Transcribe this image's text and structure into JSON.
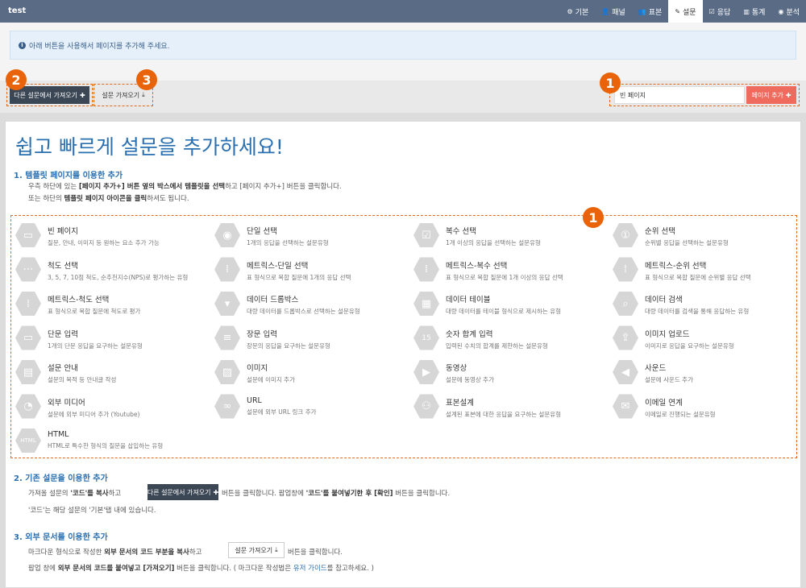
{
  "app": {
    "title": "test"
  },
  "nav": [
    {
      "label": "기본",
      "icon": "gear-icon",
      "glyph": "⚙"
    },
    {
      "label": "패널",
      "icon": "user-icon",
      "glyph": "👤"
    },
    {
      "label": "표본",
      "icon": "users-icon",
      "glyph": "👥"
    },
    {
      "label": "설문",
      "icon": "pencil-icon",
      "glyph": "✎"
    },
    {
      "label": "응답",
      "icon": "check-square-icon",
      "glyph": "☑"
    },
    {
      "label": "통계",
      "icon": "bar-chart-icon",
      "glyph": "▥"
    },
    {
      "label": "분석",
      "icon": "eye-icon",
      "glyph": "◉"
    }
  ],
  "info": {
    "icon": "info-icon",
    "text": "아래 버튼을 사용해서 페이지를 추가해 주세요."
  },
  "toolbar": {
    "import_other_label": "다른 설문에서 가져오기",
    "import_survey_label": "설문 가져오기",
    "page_input_value": "빈 페이지",
    "add_page_label": "페이지 추가",
    "badges": [
      "2",
      "3",
      "1"
    ]
  },
  "main": {
    "heading": "쉽고 빠르게 설문을 추가하세요!",
    "section1": {
      "title": "1. 템플릿 페이지를 이용한 추가",
      "line1_a": "우측 하단에 있는 ",
      "line1_b": "[페이지 추가+] 버튼 옆의 박스에서 템플릿을 선택",
      "line1_c": "하고 [페이지 추가+] 버튼을 클릭합니다.",
      "line2_a": "또는 하단의 ",
      "line2_b": "템플릿 페이지 아이콘을 클릭",
      "line2_c": "하셔도 됩니다.",
      "badge": "1"
    },
    "templates": [
      {
        "name": "빈 페이지",
        "desc": "질문, 안내, 이미지 등 원하는 요소 추가 가능",
        "icon": "blank-page-icon",
        "glyph": "▭"
      },
      {
        "name": "단일 선택",
        "desc": "1개의 응답을 선택하는 설문유형",
        "icon": "radio-icon",
        "glyph": "◉"
      },
      {
        "name": "복수 선택",
        "desc": "1개 이상의 응답을 선택하는 설문유형",
        "icon": "checkbox-multi-icon",
        "glyph": "☑"
      },
      {
        "name": "순위 선택",
        "desc": "순위별 응답을 선택하는 설문유형",
        "icon": "rank-icon",
        "glyph": "①"
      },
      {
        "name": "척도 선택",
        "desc": "3, 5, 7, 10점 척도, 순추천지수(NPS)로 평가하는 유형",
        "icon": "scale-icon",
        "glyph": "⋯"
      },
      {
        "name": "메트릭스-단일 선택",
        "desc": "표 형식으로 복합 질문에 1개의 응답 선택",
        "icon": "matrix-single-icon",
        "glyph": "⁞"
      },
      {
        "name": "메트릭스-복수 선택",
        "desc": "표 형식으로 복합 질문에 1개 이상의 응답 선택",
        "icon": "matrix-multi-icon",
        "glyph": "⁞"
      },
      {
        "name": "메트릭스-순위 선택",
        "desc": "표 형식으로 복합 질문에 순위별 응답 선택",
        "icon": "matrix-rank-icon",
        "glyph": "⁞"
      },
      {
        "name": "메트릭스-척도 선택",
        "desc": "표 형식으로 복합 질문에 척도로 평가",
        "icon": "matrix-scale-icon",
        "glyph": "⁞"
      },
      {
        "name": "데이터 드롭박스",
        "desc": "대량 데이터를 드롭박스로 선택하는 설문유형",
        "icon": "dropdown-icon",
        "glyph": "▾"
      },
      {
        "name": "데이터 테이블",
        "desc": "대량 데이터를 테이블 형식으로 제시하는 유형",
        "icon": "table-icon",
        "glyph": "▦"
      },
      {
        "name": "데이터 검색",
        "desc": "대량 데이터를 검색을 통해 응답하는 유형",
        "icon": "search-box-icon",
        "glyph": "⌕"
      },
      {
        "name": "단문 입력",
        "desc": "1개의 단문 응답을 요구하는 설문유형",
        "icon": "short-text-icon",
        "glyph": "▭"
      },
      {
        "name": "장문 입력",
        "desc": "장문의 응답을 요구하는 설문유형",
        "icon": "long-text-icon",
        "glyph": "≡"
      },
      {
        "name": "숫자 합계 입력",
        "desc": "입력된 수치의 합계를 제한하는 설문유형",
        "icon": "number-sum-icon",
        "glyph": "15"
      },
      {
        "name": "이미지 업로드",
        "desc": "이미지로 응답을 요구하는 설문유형",
        "icon": "image-upload-icon",
        "glyph": "⇪"
      },
      {
        "name": "설문 안내",
        "desc": "설문의 목적 등 안내글 작성",
        "icon": "comment-icon",
        "glyph": "▤"
      },
      {
        "name": "이미지",
        "desc": "설문에 이미지 추가",
        "icon": "image-icon",
        "glyph": "▨"
      },
      {
        "name": "동영상",
        "desc": "설문에 동영상 추가",
        "icon": "video-icon",
        "glyph": "▶"
      },
      {
        "name": "사운드",
        "desc": "설문에 사운드 추가",
        "icon": "sound-icon",
        "glyph": "◀"
      },
      {
        "name": "외부 미디어",
        "desc": "설문에 외부 미디어 추가 (Youtube)",
        "icon": "rss-icon",
        "glyph": "◔"
      },
      {
        "name": "URL",
        "desc": "설문에 외부 URL 링크 추가",
        "icon": "link-icon",
        "glyph": "∞"
      },
      {
        "name": "표본설계",
        "desc": "설계된 표본에 대한 응답을 요구하는 설문유형",
        "icon": "sample-design-icon",
        "glyph": "⚇"
      },
      {
        "name": "이메일 연계",
        "desc": "이메일로 진행되는 설문유형",
        "icon": "email-icon",
        "glyph": "✉"
      },
      {
        "name": "HTML",
        "desc": "HTML로 특수한 형식의 질문을 삽입하는 유형",
        "icon": "html-file-icon",
        "glyph": "HTML"
      }
    ],
    "section2": {
      "title": "2. 기존 설문을 이용한 추가",
      "line1_a": "가져올 설문의 ",
      "line1_b": "'코드'를 복사",
      "line1_c": "하고",
      "button_label": "다른 설문에서 가져오기",
      "line1_d": "버튼을 클릭합니다. 팝업창에 ",
      "line1_e": "'코드'를 붙여넣기한 후 [확인]",
      "line1_f": " 버튼을 클릭합니다.",
      "line2": "'코드'는 해당 설문의 '기본'탭 내에 있습니다."
    },
    "section3": {
      "title": "3. 외부 문서를 이용한 추가",
      "line1_a": "마크다운 형식으로 작성한 ",
      "line1_b": "외부 문서의 코드 부분을 복사",
      "line1_c": "하고",
      "button_label": "설문 가져오기",
      "line1_d": "버튼을 클릭합니다.",
      "line2_a": "팝업 창에 ",
      "line2_b": "외부 문서의 코드를 붙여넣고 [가져오기]",
      "line2_c": " 버튼을 클릭합니다. ( 마크다운 작성법은 ",
      "line2_link": "유저 가이드",
      "line2_d": "를 참고하세요. )"
    }
  },
  "colors": {
    "nav_bg": "#5a6b86",
    "accent": "#2a6fb0",
    "badge": "#e8630a",
    "add_button": "#ef6b5e",
    "dark_button": "#3c4756"
  }
}
